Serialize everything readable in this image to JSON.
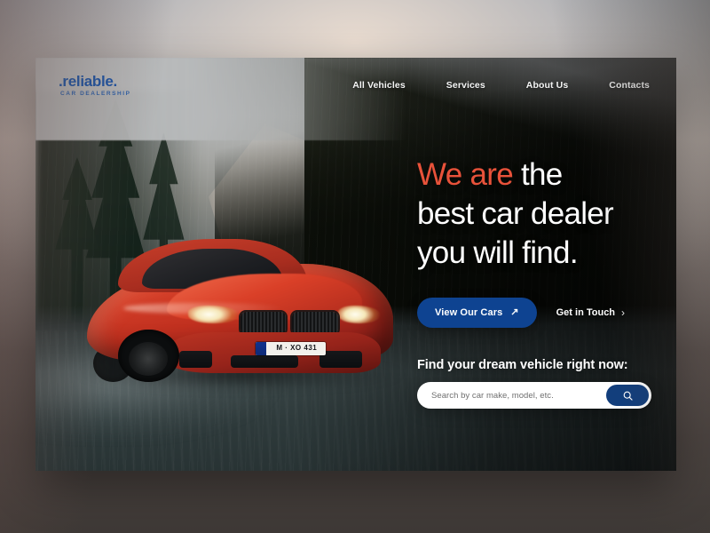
{
  "brand": {
    "name": ".reliable.",
    "tagline": "CAR DEALERSHIP",
    "color": "#1a54a8"
  },
  "nav": {
    "items": [
      {
        "label": "All Vehicles"
      },
      {
        "label": "Services"
      },
      {
        "label": "About Us"
      },
      {
        "label": "Contacts"
      }
    ]
  },
  "hero": {
    "headline": {
      "accent": "We are",
      "rest_line1": " the",
      "line2": "best car dealer",
      "line3": "you will find.",
      "accent_color": "#e8523a"
    },
    "primary_cta": {
      "label": "View Our Cars",
      "arrow": "↗",
      "color": "#0e4391"
    },
    "secondary_cta": {
      "label": "Get in Touch",
      "chevron": "›"
    },
    "search": {
      "label": "Find your dream vehicle right now:",
      "placeholder": "Search by car make, model, etc.",
      "value": "",
      "button_icon": "search-icon",
      "button_color": "#123e7c"
    }
  },
  "image": {
    "subject": "red BMW M4 coupe driving on mountain road",
    "license_plate": "M · XO 431"
  }
}
